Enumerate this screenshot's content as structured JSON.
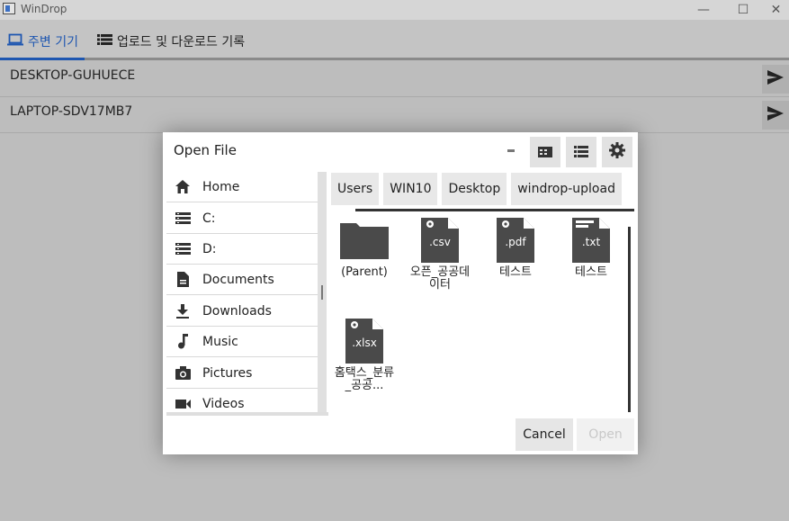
{
  "window": {
    "title": "WinDrop",
    "minimize": "—",
    "maximize": "☐",
    "close": "✕"
  },
  "tabs": [
    {
      "label": "주변 기기",
      "icon": "laptop-icon",
      "active": true
    },
    {
      "label": "업로드 및 다운로드 기록",
      "icon": "list-icon",
      "active": false
    }
  ],
  "devices": [
    {
      "name": "DESKTOP-GUHUECE"
    },
    {
      "name": "LAPTOP-SDV17MB7"
    }
  ],
  "dialog": {
    "title": "Open File",
    "sidebar": [
      {
        "label": "Home",
        "icon": "home-icon"
      },
      {
        "label": "C:",
        "icon": "drive-icon"
      },
      {
        "label": "D:",
        "icon": "drive-icon"
      },
      {
        "label": "Documents",
        "icon": "document-icon"
      },
      {
        "label": "Downloads",
        "icon": "download-icon"
      },
      {
        "label": "Music",
        "icon": "music-icon"
      },
      {
        "label": "Pictures",
        "icon": "camera-icon"
      },
      {
        "label": "Videos",
        "icon": "video-icon"
      }
    ],
    "breadcrumbs": [
      "Users",
      "WIN10",
      "Desktop",
      "windrop-upload"
    ],
    "files": [
      {
        "label": "(Parent)",
        "icon": "folder-icon",
        "ext": ""
      },
      {
        "label": "오픈_공공데이터",
        "icon": "csv-file-icon",
        "ext": ".csv"
      },
      {
        "label": "테스트",
        "icon": "pdf-file-icon",
        "ext": ".pdf"
      },
      {
        "label": "테스트",
        "icon": "txt-file-icon",
        "ext": ".txt"
      },
      {
        "label": "홈택스_분류_공공...",
        "icon": "xlsx-file-icon",
        "ext": ".xlsx"
      }
    ],
    "cancel_label": "Cancel",
    "open_label": "Open"
  },
  "colors": {
    "accent": "#1e56b0",
    "background": "#bdbdbd",
    "icon_dark": "#4a4a4a"
  }
}
